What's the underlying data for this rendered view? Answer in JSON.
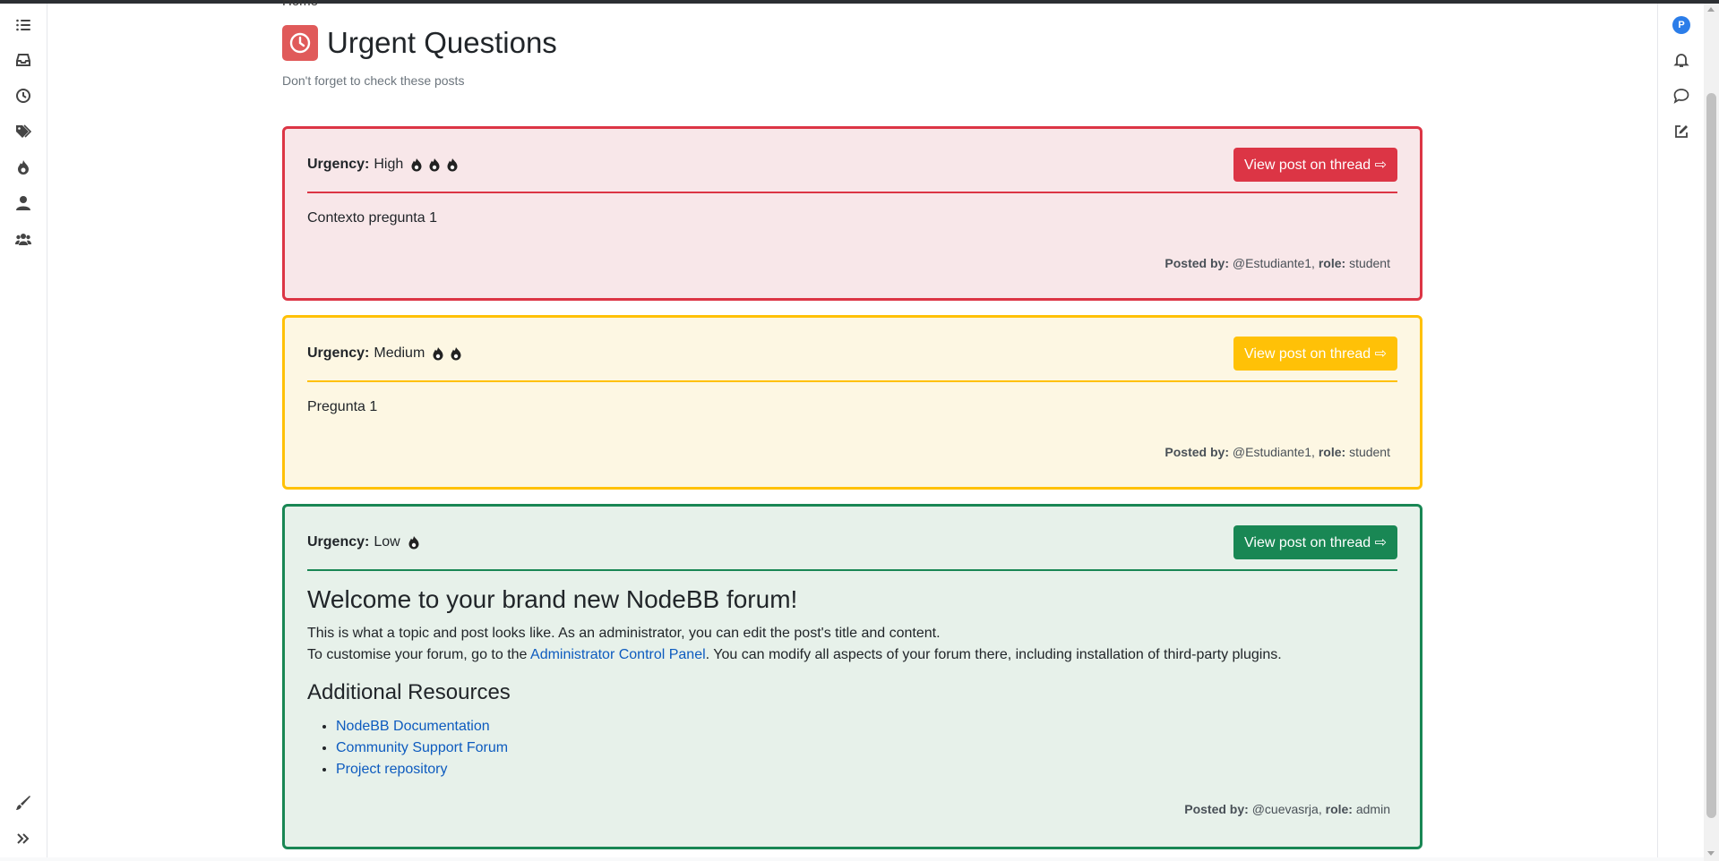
{
  "breadcrumb": "Home",
  "page": {
    "title": "Urgent Questions",
    "subtitle": "Don't forget to check these posts"
  },
  "colors": {
    "high": "#dc3545",
    "medium": "#ffc107",
    "low": "#198754",
    "avatar": "#2b7de9"
  },
  "sidebar_left": {
    "icons": [
      "list-icon",
      "inbox-icon",
      "clock-icon",
      "tags-icon",
      "fire-icon",
      "user-icon",
      "users-icon",
      "brush-icon",
      "chevron-double-right-icon"
    ]
  },
  "sidebar_right": {
    "avatar_letter": "P",
    "icons": [
      "bell-icon",
      "chat-icon",
      "compose-icon"
    ]
  },
  "labels": {
    "urgency": "Urgency:",
    "posted_by": "Posted by:",
    "role": "role:",
    "button": "View post on thread ⇨"
  },
  "posts": [
    {
      "urgency": "High",
      "flames": 3,
      "content": "Contexto pregunta 1",
      "author": "@Estudiante1,",
      "role": "student"
    },
    {
      "urgency": "Medium",
      "flames": 2,
      "content": "Pregunta 1",
      "author": "@Estudiante1,",
      "role": "student"
    },
    {
      "urgency": "Low",
      "flames": 1,
      "welcome_title": "Welcome to your brand new NodeBB forum!",
      "line1": "This is what a topic and post looks like. As an administrator, you can edit the post's title and content.",
      "line2_pre": "To customise your forum, go to the ",
      "line2_link": "Administrator Control Panel",
      "line2_post": ". You can modify all aspects of your forum there, including installation of third-party plugins.",
      "resources_title": "Additional Resources",
      "resources": [
        "NodeBB Documentation",
        "Community Support Forum",
        "Project repository"
      ],
      "author": "@cuevasrja,",
      "role": "admin"
    }
  ]
}
